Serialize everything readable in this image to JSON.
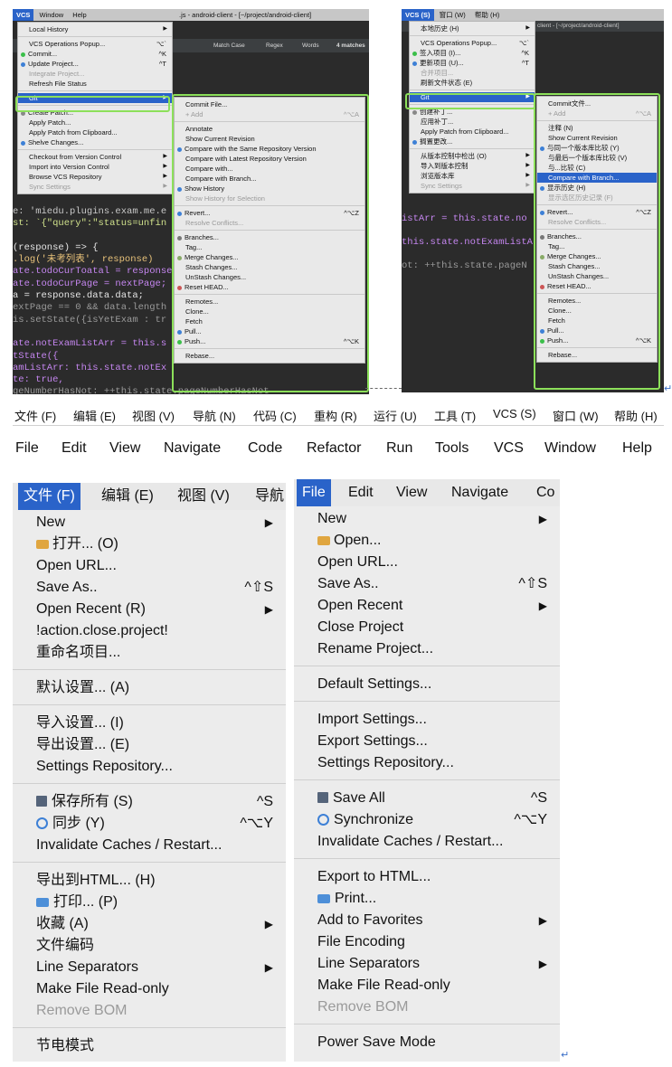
{
  "left_shot": {
    "menubar": [
      "VCS",
      "Window",
      "Help"
    ],
    "title": ".js - android-client - [~/project/android-client]",
    "find_bar": {
      "match_case": "Match Case",
      "regex": "Regex",
      "words": "Words",
      "matches": "4 matches"
    },
    "code_lines": [
      {
        "text": "e: 'miedu.plugins.exam.me.e",
        "color": "#c8c8c8"
      },
      {
        "text": "st: `{\"query\":\"status=unfin",
        "color": "#cfe08b"
      },
      {
        "text": "",
        "color": "#ccc"
      },
      {
        "text": "(response) => {",
        "color": "#e6e6e6"
      },
      {
        "text": ".log('未考列表', response)",
        "color": "#e8c27a"
      },
      {
        "text": "ate.todoCurToatal = response",
        "color": "#c586f0"
      },
      {
        "text": "ate.todoCurPage = nextPage;",
        "color": "#c586f0"
      },
      {
        "text": "a = response.data.data;",
        "color": "#e6e6e6"
      },
      {
        "text": "extPage == 0 && data.length",
        "color": "#9a9a9a"
      },
      {
        "text": "is.setState({isYetExam : tr",
        "color": "#9a9a9a"
      },
      {
        "text": "",
        "color": "#ccc"
      },
      {
        "text": "ate.notExamListArr = this.s",
        "color": "#c586f0"
      },
      {
        "text": "tState({",
        "color": "#c586f0"
      },
      {
        "text": "amListArr: this.state.notEx",
        "color": "#c586f0"
      },
      {
        "text": "te: true,",
        "color": "#c586f0"
      },
      {
        "text": "geNumberHasNot: ++this.state.pageNumberHasNot",
        "color": "#9a9a9a"
      }
    ],
    "vcs_menu": [
      {
        "label": "Local History",
        "arrow": true
      },
      {
        "sep": true
      },
      {
        "label": "VCS Operations Popup...",
        "sc": "⌥`"
      },
      {
        "label": "Commit...",
        "sc": "^K",
        "icon": "green-dot"
      },
      {
        "label": "Update Project...",
        "sc": "^T",
        "icon": "blue-arrow"
      },
      {
        "label": "Integrate Project...",
        "dis": true
      },
      {
        "label": "Refresh File Status"
      },
      {
        "sep": true
      },
      {
        "label": "Git",
        "arrow": true,
        "hl": true
      },
      {
        "sep": true
      },
      {
        "label": "Create Patch...",
        "icon": "patch"
      },
      {
        "label": "Apply Patch..."
      },
      {
        "label": "Apply Patch from Clipboard..."
      },
      {
        "label": "Shelve Changes...",
        "icon": "blue-arrow"
      },
      {
        "sep": true
      },
      {
        "label": "Checkout from Version Control",
        "arrow": true
      },
      {
        "label": "Import into Version Control",
        "arrow": true
      },
      {
        "label": "Browse VCS Repository",
        "arrow": true
      },
      {
        "label": "Sync Settings",
        "arrow": true,
        "dis": true
      }
    ],
    "git_menu": [
      {
        "label": "Commit File..."
      },
      {
        "label": "+ Add",
        "sc": "^⌥A",
        "dis": true
      },
      {
        "sep": true
      },
      {
        "label": "Annotate"
      },
      {
        "label": "Show Current Revision"
      },
      {
        "label": "Compare with the Same Repository Version",
        "icon": "compare"
      },
      {
        "label": "Compare with Latest Repository Version"
      },
      {
        "label": "Compare with..."
      },
      {
        "label": "Compare with Branch..."
      },
      {
        "label": "Show History",
        "icon": "history"
      },
      {
        "label": "Show History for Selection",
        "dis": true
      },
      {
        "sep": true
      },
      {
        "label": "Revert...",
        "sc": "^⌥Z",
        "icon": "revert"
      },
      {
        "label": "Resolve Conflicts...",
        "dis": true
      },
      {
        "sep": true
      },
      {
        "label": "Branches...",
        "icon": "branch"
      },
      {
        "label": "Tag..."
      },
      {
        "label": "Merge Changes...",
        "icon": "merge"
      },
      {
        "label": "Stash Changes..."
      },
      {
        "label": "UnStash Changes..."
      },
      {
        "label": "Reset HEAD...",
        "icon": "reset"
      },
      {
        "sep": true
      },
      {
        "label": "Remotes..."
      },
      {
        "label": "Clone..."
      },
      {
        "label": "Fetch"
      },
      {
        "label": "Pull...",
        "icon": "pull"
      },
      {
        "label": "Push...",
        "sc": "^⌥K",
        "icon": "push"
      },
      {
        "sep": true
      },
      {
        "label": "Rebase..."
      }
    ]
  },
  "right_shot": {
    "menubar": [
      "VCS (S)",
      "窗口 (W)",
      "帮助 (H)"
    ],
    "title": "client - [~/project/android-client]",
    "code_lines": [
      {
        "text": "istArr = this.state.no",
        "color": "#c586f0"
      },
      {
        "text": "",
        "color": "#ccc"
      },
      {
        "text": "this.state.notExamListA",
        "color": "#c586f0"
      },
      {
        "text": "",
        "color": "#ccc"
      },
      {
        "text": "ot: ++this.state.pageN",
        "color": "#9a9a9a"
      }
    ],
    "vcs_menu": [
      {
        "label": "本地历史 (H)",
        "arrow": true
      },
      {
        "sep": true
      },
      {
        "label": "VCS Operations Popup...",
        "sc": "⌥`"
      },
      {
        "label": "签入项目 (I)...",
        "sc": "^K",
        "icon": "green-dot"
      },
      {
        "label": "更新项目 (U)...",
        "sc": "^T",
        "icon": "blue-arrow"
      },
      {
        "label": "合并项目...",
        "dis": true
      },
      {
        "label": "刷新文件状态 (E)"
      },
      {
        "sep": true
      },
      {
        "label": "Git",
        "arrow": true,
        "hl": true
      },
      {
        "sep": true
      },
      {
        "label": "创建补丁...",
        "icon": "patch"
      },
      {
        "label": "应用补丁..."
      },
      {
        "label": "Apply Patch from Clipboard..."
      },
      {
        "label": "搁置更改...",
        "icon": "blue-arrow"
      },
      {
        "sep": true
      },
      {
        "label": "从版本控制中检出 (O)",
        "arrow": true
      },
      {
        "label": "导入到版本控制",
        "arrow": true
      },
      {
        "label": "浏览版本库",
        "arrow": true
      },
      {
        "label": "Sync Settings",
        "arrow": true,
        "dis": true
      }
    ],
    "git_menu": [
      {
        "label": "Commit文件..."
      },
      {
        "label": "+ Add",
        "sc": "^⌥A",
        "dis": true
      },
      {
        "sep": true
      },
      {
        "label": "注释 (N)"
      },
      {
        "label": "Show Current Revision"
      },
      {
        "label": "与同一个版本库比较 (Y)",
        "icon": "compare"
      },
      {
        "label": "与最后一个版本库比较 (V)"
      },
      {
        "label": "与...比较 (C)"
      },
      {
        "label": "Compare with Branch...",
        "hl": true
      },
      {
        "label": "显示历史 (H)",
        "icon": "history"
      },
      {
        "label": "显示选区历史记录 (F)",
        "dis": true
      },
      {
        "sep": true
      },
      {
        "label": "Revert...",
        "sc": "^⌥Z",
        "icon": "revert"
      },
      {
        "label": "Resolve Conflicts...",
        "dis": true
      },
      {
        "sep": true
      },
      {
        "label": "Branches...",
        "icon": "branch"
      },
      {
        "label": "Tag..."
      },
      {
        "label": "Merge Changes...",
        "icon": "merge"
      },
      {
        "label": "Stash Changes..."
      },
      {
        "label": "UnStash Changes..."
      },
      {
        "label": "Reset HEAD...",
        "icon": "reset"
      },
      {
        "sep": true
      },
      {
        "label": "Remotes..."
      },
      {
        "label": "Clone..."
      },
      {
        "label": "Fetch"
      },
      {
        "label": "Pull...",
        "icon": "pull"
      },
      {
        "label": "Push...",
        "sc": "^⌥K",
        "icon": "push"
      },
      {
        "sep": true
      },
      {
        "label": "Rebase..."
      }
    ]
  },
  "menubar_cn": [
    "文件 (F)",
    "编辑 (E)",
    "视图 (V)",
    "导航 (N)",
    "代码 (C)",
    "重构 (R)",
    "运行 (U)",
    "工具 (T)",
    "VCS (S)",
    "窗口 (W)",
    "帮助 (H)"
  ],
  "menubar_en": [
    "File",
    "Edit",
    "View",
    "Navigate",
    "Code",
    "Refactor",
    "Run",
    "Tools",
    "VCS",
    "Window",
    "Help"
  ],
  "file_menu_cn": {
    "header": [
      "文件 (F)",
      "编辑 (E)",
      "视图 (V)",
      "导航"
    ],
    "items": [
      {
        "label": "New",
        "arrow": true
      },
      {
        "label": "打开... (O)",
        "icon": "folder"
      },
      {
        "label": "Open URL..."
      },
      {
        "label": "Save As..",
        "sc": "^⇧S"
      },
      {
        "label": "Open Recent (R)",
        "arrow": true
      },
      {
        "label": "!action.close.project!"
      },
      {
        "label": "重命名项目..."
      },
      {
        "sep": true
      },
      {
        "label": "默认设置... (A)"
      },
      {
        "sep": true
      },
      {
        "label": "导入设置... (I)"
      },
      {
        "label": "导出设置... (E)"
      },
      {
        "label": "Settings Repository..."
      },
      {
        "sep": true
      },
      {
        "label": "保存所有 (S)",
        "sc": "^S",
        "icon": "disk"
      },
      {
        "label": "同步 (Y)",
        "sc": "^⌥Y",
        "icon": "sync"
      },
      {
        "label": "Invalidate Caches / Restart..."
      },
      {
        "sep": true
      },
      {
        "label": "导出到HTML... (H)"
      },
      {
        "label": "打印... (P)",
        "icon": "print"
      },
      {
        "label": "收藏 (A)",
        "arrow": true
      },
      {
        "label": "文件编码"
      },
      {
        "label": "Line Separators",
        "arrow": true
      },
      {
        "label": "Make File Read-only"
      },
      {
        "label": "Remove BOM",
        "dis": true
      },
      {
        "sep": true
      },
      {
        "label": "节电模式"
      }
    ]
  },
  "file_menu_en": {
    "header": [
      "File",
      "Edit",
      "View",
      "Navigate",
      "Co"
    ],
    "items": [
      {
        "label": "New",
        "arrow": true
      },
      {
        "label": "Open...",
        "icon": "folder"
      },
      {
        "label": "Open URL..."
      },
      {
        "label": "Save As..",
        "sc": "^⇧S"
      },
      {
        "label": "Open Recent",
        "arrow": true
      },
      {
        "label": "Close Project"
      },
      {
        "label": "Rename Project..."
      },
      {
        "sep": true
      },
      {
        "label": "Default Settings..."
      },
      {
        "sep": true
      },
      {
        "label": "Import Settings..."
      },
      {
        "label": "Export Settings..."
      },
      {
        "label": "Settings Repository..."
      },
      {
        "sep": true
      },
      {
        "label": "Save All",
        "sc": "^S",
        "icon": "disk"
      },
      {
        "label": "Synchronize",
        "sc": "^⌥Y",
        "icon": "sync"
      },
      {
        "label": "Invalidate Caches / Restart..."
      },
      {
        "sep": true
      },
      {
        "label": "Export to HTML..."
      },
      {
        "label": "Print...",
        "icon": "print"
      },
      {
        "label": "Add to Favorites",
        "arrow": true
      },
      {
        "label": "File Encoding"
      },
      {
        "label": "Line Separators",
        "arrow": true
      },
      {
        "label": "Make File Read-only"
      },
      {
        "label": "Remove BOM",
        "dis": true
      },
      {
        "sep": true
      },
      {
        "label": "Power Save Mode"
      }
    ]
  },
  "colors": {
    "highlight": "#2a63c9",
    "frame": "#8ce05a",
    "code_bg": "#2b2b2b"
  }
}
